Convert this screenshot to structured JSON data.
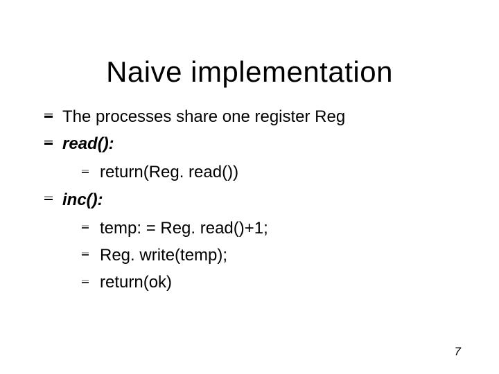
{
  "title": "Naive implementation",
  "bullets": {
    "intro": "The processes share one register Reg",
    "read_label": "read():",
    "read_body": "return(Reg. read())",
    "inc_label": "inc():",
    "inc_body1": "temp: = Reg. read()+1;",
    "inc_body2": "Reg. write(temp);",
    "inc_body3": "return(ok)"
  },
  "page_number": "7"
}
